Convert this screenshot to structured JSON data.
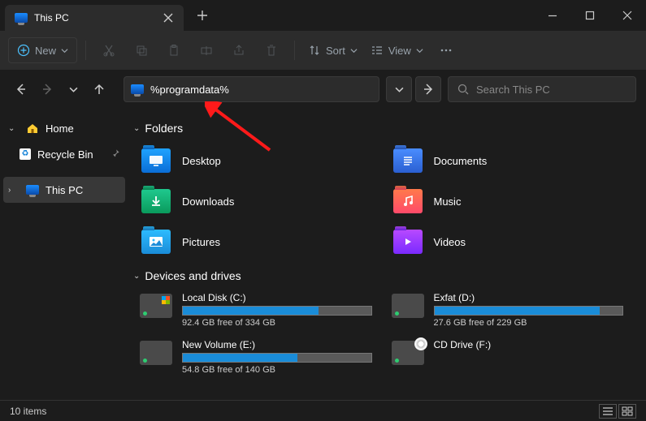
{
  "tab": {
    "title": "This PC"
  },
  "toolbar": {
    "new_label": "New",
    "sort_label": "Sort",
    "view_label": "View"
  },
  "address": {
    "value": "%programdata%"
  },
  "search": {
    "placeholder": "Search This PC"
  },
  "sidebar": {
    "home": "Home",
    "recycle": "Recycle Bin",
    "thispc": "This PC"
  },
  "groups": {
    "folders": "Folders",
    "drives": "Devices and drives"
  },
  "folders": [
    {
      "name": "Desktop"
    },
    {
      "name": "Documents"
    },
    {
      "name": "Downloads"
    },
    {
      "name": "Music"
    },
    {
      "name": "Pictures"
    },
    {
      "name": "Videos"
    }
  ],
  "drives": [
    {
      "name": "Local Disk (C:)",
      "free": "92.4 GB free of 334 GB",
      "fill": 72
    },
    {
      "name": "Exfat (D:)",
      "free": "27.6 GB free of 229 GB",
      "fill": 88
    },
    {
      "name": "New Volume (E:)",
      "free": "54.8 GB free of 140 GB",
      "fill": 61
    },
    {
      "name": "CD Drive (F:)",
      "free": "",
      "fill": 0
    }
  ],
  "status": {
    "items": "10 items"
  }
}
